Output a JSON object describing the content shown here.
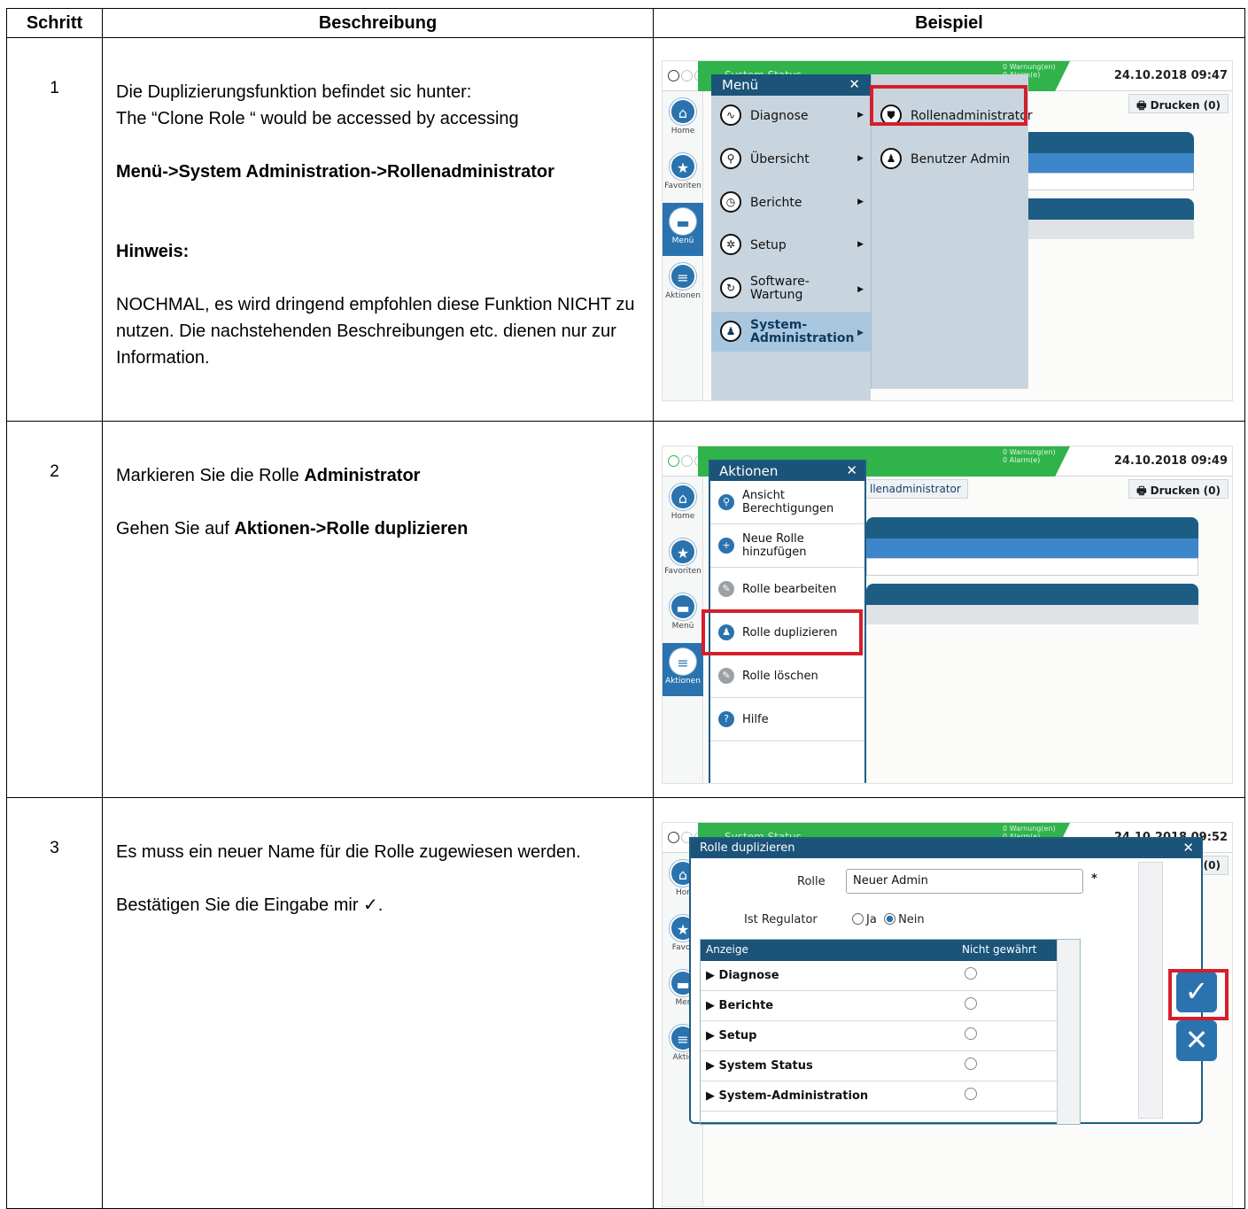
{
  "headers": {
    "schritt": "Schritt",
    "beschreibung": "Beschreibung",
    "beispiel": "Beispiel"
  },
  "steps": [
    {
      "num": "1",
      "line1": "Die Duplizierungsfunktion befindet sic hunter:",
      "line2": "The “Clone Role “ would be accessed by accessing",
      "path": "Menü->System Administration->Rollenadministrator",
      "hint_title": "Hinweis:",
      "hint_text": "NOCHMAL, es wird dringend empfohlen diese Funktion NICHT zu nutzen. Die nachstehenden Beschreibungen etc. dienen nur zur Information."
    },
    {
      "num": "2",
      "line1_pre": "Markieren Sie die Rolle ",
      "line1_bold": "Administrator",
      "line2_pre": "Gehen Sie auf ",
      "line2_bold": "Aktionen->Rolle duplizieren"
    },
    {
      "num": "3",
      "line1": "Es muss ein neuer Name für die Rolle zugewiesen werden.",
      "line2": "Bestätigen Sie die Eingabe mir ✓."
    }
  ],
  "screen1": {
    "status": "System Status",
    "warning": "0 Warnung(en)",
    "alarm": "0 Alarm(e)",
    "datetime": "24.10.2018 09:47",
    "print": "Drucken (0)",
    "sidebar": [
      "Home",
      "Favoriten",
      "Menü",
      "Aktionen"
    ],
    "menu_title": "Menü",
    "menu_items": [
      "Diagnose",
      "Übersicht",
      "Berichte",
      "Setup",
      "Software-\nWartung",
      "System-\nAdministration"
    ],
    "submenu_items": [
      "Rollenadministrator",
      "Benutzer Admin"
    ]
  },
  "screen2": {
    "warning": "0 Warnung(en)",
    "alarm": "0 Alarm(e)",
    "datetime": "24.10.2018 09:49",
    "crumb": "llenadministrator",
    "print": "Drucken (0)",
    "sidebar": [
      "Home",
      "Favoriten",
      "Menü",
      "Aktionen"
    ],
    "actions_title": "Aktionen",
    "actions": [
      "Ansicht\nBerechtigungen",
      "Neue Rolle\nhinzufügen",
      "Rolle bearbeiten",
      "Rolle duplizieren",
      "Rolle löschen",
      "Hilfe"
    ]
  },
  "screen3": {
    "status": "System Status",
    "warning": "0 Warnung(en)",
    "alarm": "0 Alarm(e)",
    "datetime": "24.10.2018 09:52",
    "print_partial": "n (0)",
    "sidebar": [
      "Hor",
      "Favor",
      "Mer",
      "Aktio"
    ],
    "dialog_title": "Rolle duplizieren",
    "role_label": "Rolle",
    "role_value": "Neuer Admin",
    "required": "*",
    "regulator_label": "Ist Regulator",
    "ja": "Ja",
    "nein": "Nein",
    "col_anzeige": "Anzeige",
    "col_nicht": "Nicht gewährt",
    "rows": [
      "Diagnose",
      "Berichte",
      "Setup",
      "System Status",
      "System-Administration"
    ]
  }
}
